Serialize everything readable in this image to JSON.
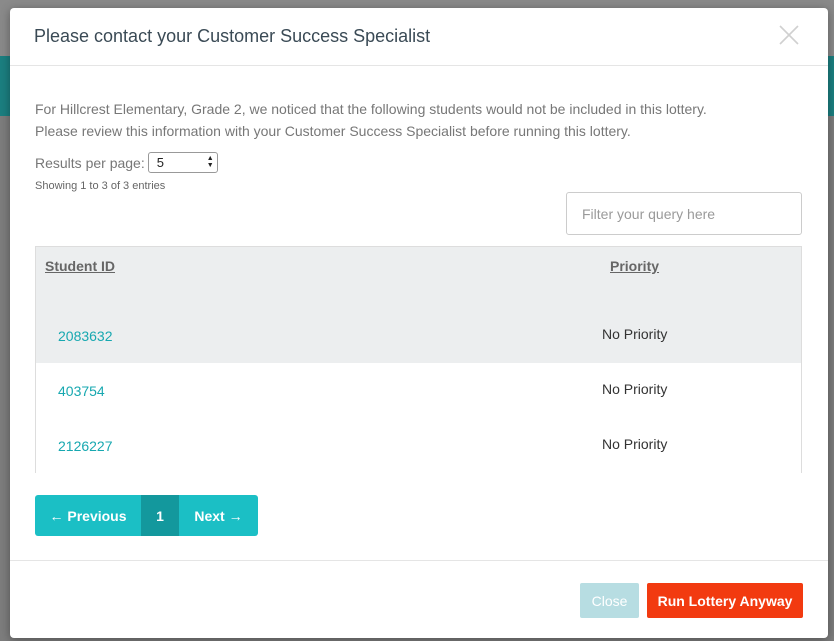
{
  "modal": {
    "title": "Please contact your Customer Success Specialist",
    "notice_line1": "For Hillcrest Elementary, Grade 2, we noticed that the following students would not be included in this lottery.",
    "notice_line2": "Please review this information with your Customer Success Specialist before running this lottery.",
    "results_per_page_label": "Results per page:",
    "results_per_page_value": "5",
    "showing_text": "Showing 1 to 3 of 3 entries",
    "filter_placeholder": "Filter your query here"
  },
  "table": {
    "columns": [
      "Student ID",
      "Priority"
    ],
    "rows": [
      {
        "student_id": "2083632",
        "priority": "No Priority"
      },
      {
        "student_id": "403754",
        "priority": "No Priority"
      },
      {
        "student_id": "2126227",
        "priority": "No Priority"
      }
    ]
  },
  "pagination": {
    "previous": "← Previous",
    "current": "1",
    "next": "Next →"
  },
  "footer": {
    "close_label": "Close",
    "run_label": "Run Lottery Anyway"
  },
  "colors": {
    "accent": "#1bbfc5",
    "danger": "#f23a10"
  },
  "icons": {
    "close": "close-icon"
  }
}
